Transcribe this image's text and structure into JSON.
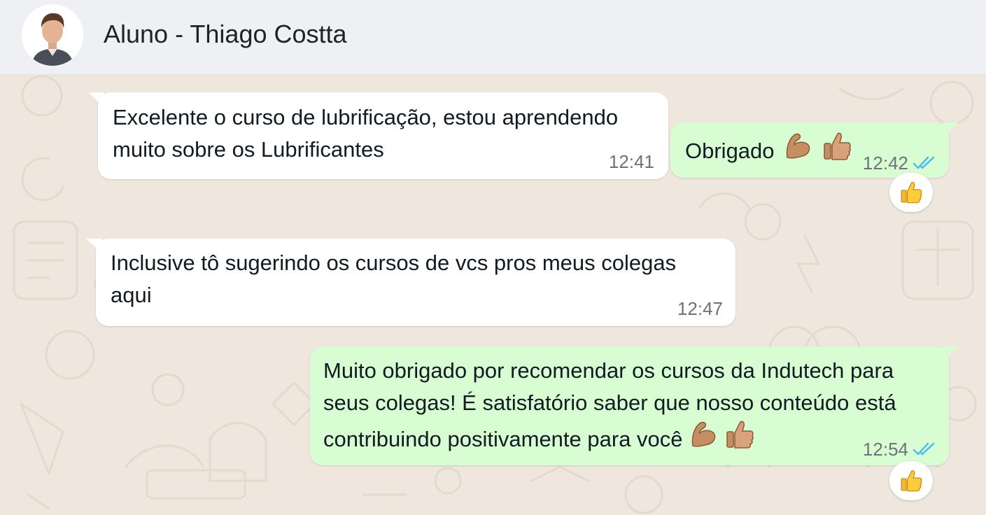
{
  "header": {
    "contact_name": "Aluno - Thiago Costta",
    "avatar_icon": "profile-photo"
  },
  "colors": {
    "header_bg": "#eef0f3",
    "chat_bg": "#efe7de",
    "incoming_bubble": "#ffffff",
    "outgoing_bubble": "#d9fdd3",
    "read_ticks": "#53bdeb"
  },
  "messages": [
    {
      "direction": "incoming",
      "lines": [
        "Excelente o curso de lubrificação, estou aprendendo",
        "muito sobre os Lubrificantes"
      ],
      "time": "12:41"
    },
    {
      "direction": "outgoing",
      "text": "Obrigado",
      "emojis": [
        "flexed-biceps",
        "thumbs-up"
      ],
      "time": "12:42",
      "status": "read",
      "reaction": "thumbs-up"
    },
    {
      "direction": "incoming",
      "lines": [
        "Inclusive tô sugerindo os cursos de vcs pros meus colegas",
        "aqui"
      ],
      "time": "12:47"
    },
    {
      "direction": "outgoing",
      "lines": [
        "Muito obrigado por recomendar os cursos da Indutech para",
        "seus colegas! É satisfatório saber que nosso conteúdo está",
        "contribuindo positivamente para você"
      ],
      "emojis": [
        "flexed-biceps",
        "thumbs-up"
      ],
      "time": "12:54",
      "status": "read",
      "reaction": "thumbs-up"
    }
  ]
}
